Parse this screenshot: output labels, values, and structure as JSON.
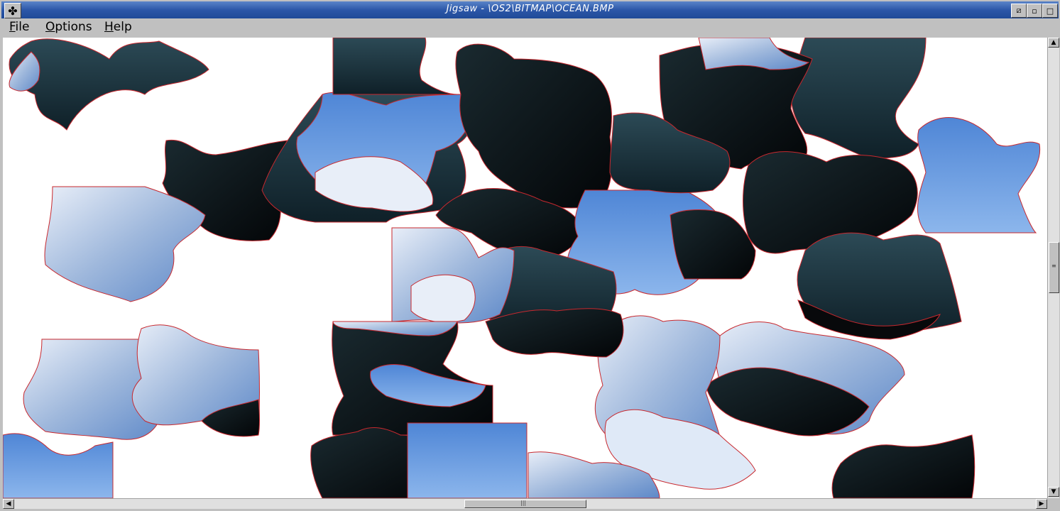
{
  "window": {
    "title": "Jigsaw - \\OS2\\BITMAP\\OCEAN.BMP",
    "controls": {
      "restore": "⧄",
      "minimize": "▫",
      "close": "□"
    }
  },
  "menu": [
    {
      "label": "File"
    },
    {
      "label": "Options"
    },
    {
      "label": "Help"
    }
  ],
  "icons": {
    "sysmenu": "puzzle-piece-icon"
  },
  "colors": {
    "piece_outline": "#c8282e",
    "sky": "#6a9fe0",
    "ocean_dark": "#0c1218",
    "ocean_teal": "#1e3a44",
    "cloud": "#dfe9f7"
  },
  "scroll": {
    "vertical_position": 0.45,
    "horizontal_position": 0.45
  }
}
